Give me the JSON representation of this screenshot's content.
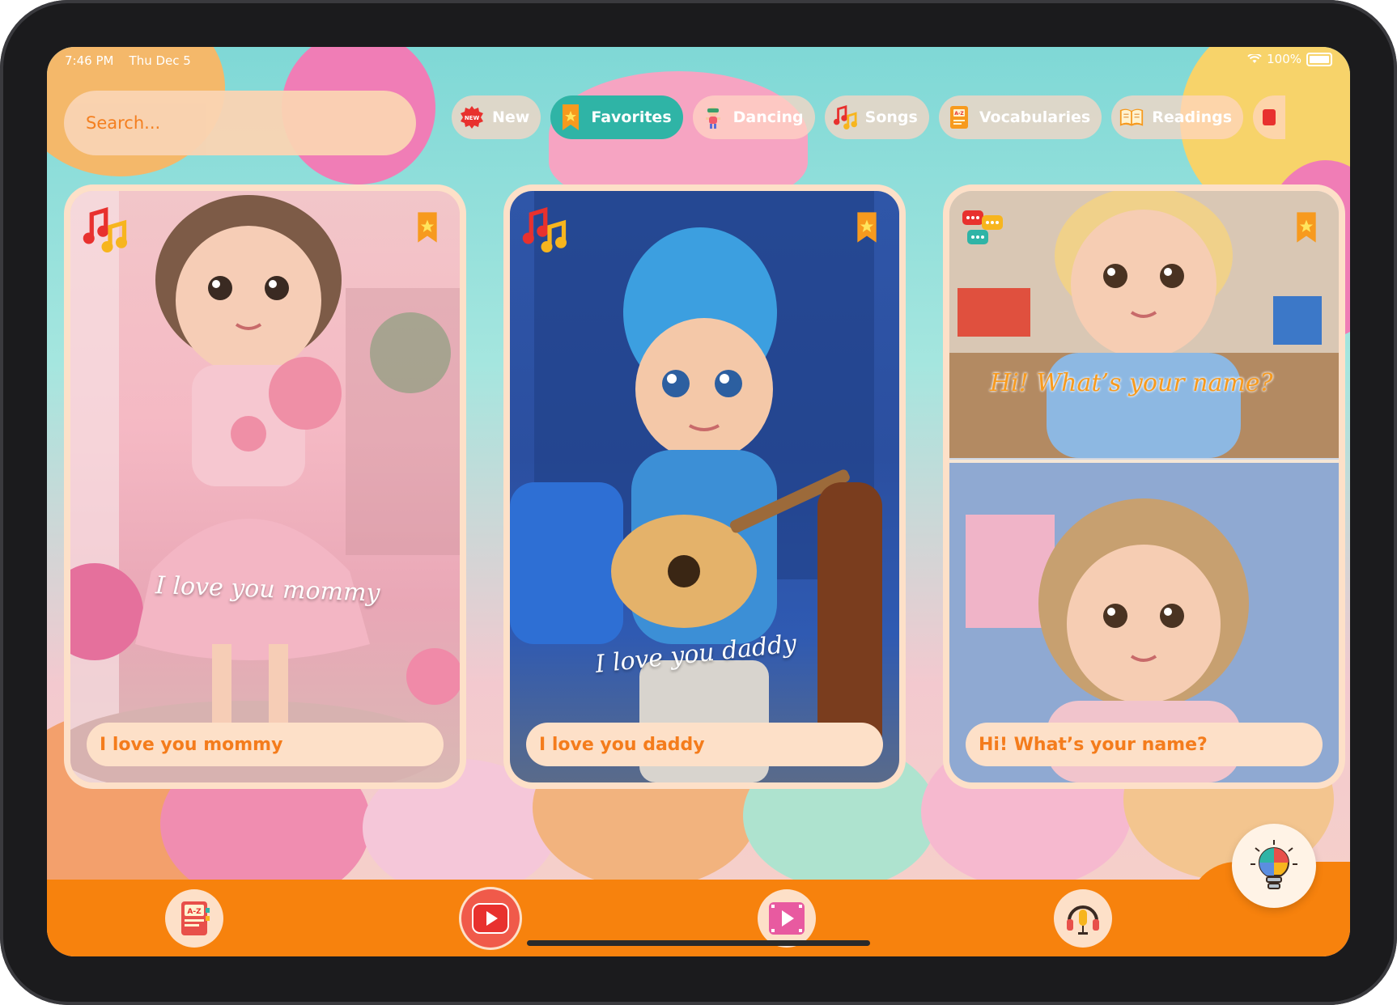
{
  "status_bar": {
    "time": "7:46 PM",
    "date": "Thu Dec 5",
    "battery": "100%"
  },
  "search": {
    "placeholder": "Search..."
  },
  "categories": [
    {
      "label": "New",
      "icon": "new-badge-icon",
      "active": false
    },
    {
      "label": "Favorites",
      "icon": "bookmark-star-icon",
      "active": true
    },
    {
      "label": "Dancing",
      "icon": "dancing-icon",
      "active": false
    },
    {
      "label": "Songs",
      "icon": "music-notes-icon",
      "active": false
    },
    {
      "label": "Vocabularies",
      "icon": "vocabulary-book-icon",
      "active": false
    },
    {
      "label": "Readings",
      "icon": "open-book-icon",
      "active": false
    }
  ],
  "cards": [
    {
      "title": "I love you mommy",
      "caption": "I love you mommy",
      "type_icon": "music-notes-icon",
      "favorite": true
    },
    {
      "title": "I love you daddy",
      "caption": "I love you daddy",
      "type_icon": "music-notes-icon",
      "favorite": true
    },
    {
      "title": "Hi! What’s your name?",
      "caption": "Hi! What’s your name?",
      "type_icon": "chat-bubbles-icon",
      "favorite": true
    }
  ],
  "tabs": [
    {
      "icon": "alphabet-book-icon",
      "active": false
    },
    {
      "icon": "play-button-icon",
      "active": true
    },
    {
      "icon": "video-player-icon",
      "active": false
    },
    {
      "icon": "podcast-microphone-icon",
      "active": false
    }
  ],
  "fab": {
    "icon": "lightbulb-puzzle-icon"
  },
  "colors": {
    "accent": "#f7820d",
    "active_chip": "#2fb4a6",
    "text_orange": "#f47c1c",
    "label_bg": "#fde0c8"
  }
}
